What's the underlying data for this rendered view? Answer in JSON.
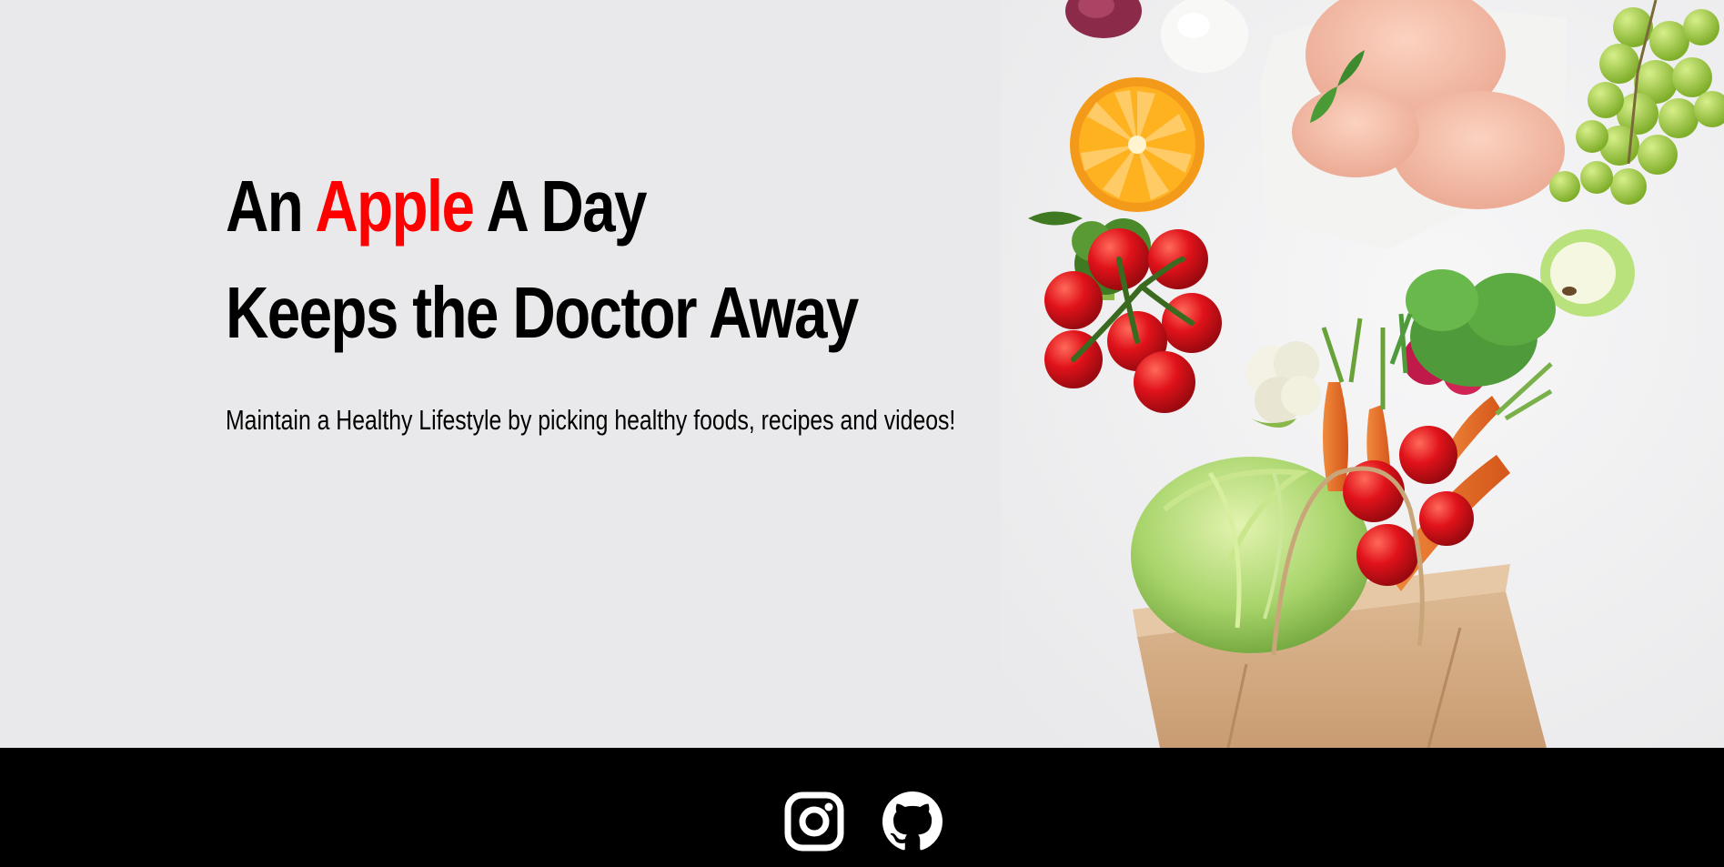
{
  "hero": {
    "headline_line1_prefix": "An ",
    "headline_line1_accent": "Apple",
    "headline_line1_suffix": " A Day",
    "headline_line2": "Keeps the Doctor Away",
    "subtitle": "Maintain a Healthy Lifestyle by picking healthy foods, recipes and videos!",
    "image": "groceries-in-paper-bag"
  },
  "footer": {
    "links": [
      {
        "icon": "instagram-icon"
      },
      {
        "icon": "github-icon"
      }
    ]
  },
  "colors": {
    "hero_background": "#e9e9eb",
    "accent": "#ff0000",
    "text": "#000000",
    "footer_background": "#000000",
    "footer_icon": "#ffffff"
  }
}
